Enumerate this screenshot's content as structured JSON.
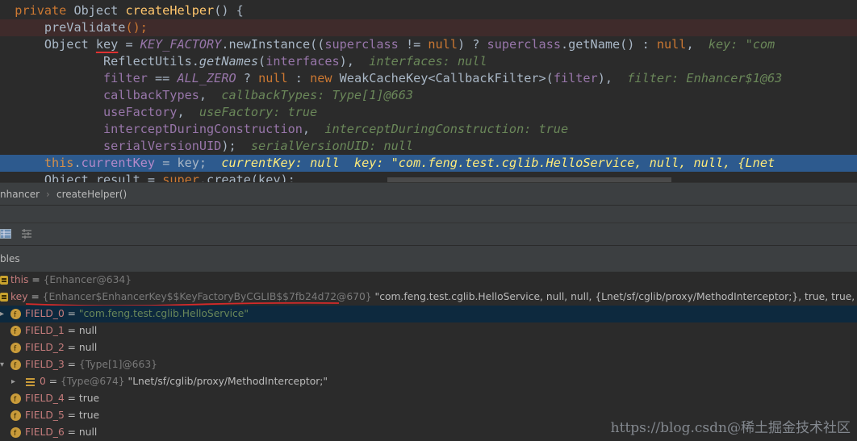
{
  "code": {
    "line1": {
      "kw": "private",
      "type": " Object ",
      "fn": "createHelper",
      "rest": "() {"
    },
    "line2": {
      "call": "preValidate",
      "rest": "();"
    },
    "line3": {
      "a": "Object ",
      "key": "key",
      "b": " = ",
      "const": "KEY_FACTORY",
      "c": ".newInstance((",
      "fld1": "superclass",
      "d": " != ",
      "kw": "null",
      "e": ") ? ",
      "fld2": "superclass",
      "f": ".getName() : ",
      "kw2": "null",
      "g": ",  ",
      "hint": "key: \"com"
    },
    "line4": {
      "a": "ReflectUtils.",
      "st": "getNames",
      "b": "(",
      "fld": "interfaces",
      "c": "),  ",
      "hint": "interfaces: null"
    },
    "line5": {
      "fld": "filter",
      "a": " == ",
      "const": "ALL_ZERO",
      "b": " ? ",
      "kw": "null",
      "c": " : ",
      "kw2": "new",
      "d": " WeakCacheKey<CallbackFilter>(",
      "fld2": "filter",
      "e": "),  ",
      "hint": "filter: Enhancer$1@63"
    },
    "line6": {
      "fld": "callbackTypes",
      "a": ",  ",
      "hint": "callbackTypes: Type[1]@663"
    },
    "line7": {
      "fld": "useFactory",
      "a": ",  ",
      "hint": "useFactory: true"
    },
    "line8": {
      "fld": "interceptDuringConstruction",
      "a": ",  ",
      "hint": "interceptDuringConstruction: true"
    },
    "line9": {
      "fld": "serialVersionUID",
      "a": ");  ",
      "hint": "serialVersionUID: null"
    },
    "line10": {
      "kw": "this",
      "a": ".",
      "fld": "currentKey",
      "b": " = key;  ",
      "hint": "currentKey: null  key: \"com.feng.test.cglib.HelloService, null, null, {Lnet"
    },
    "line11": {
      "a": "Object result = ",
      "kw": "super",
      "b": ".create(key);"
    }
  },
  "breadcrumb": {
    "item1": "nhancer",
    "sep": "›",
    "item2": "createHelper()"
  },
  "panel": {
    "title": "bles"
  },
  "toolbar": {
    "icon1": "table-icon",
    "icon2": "settings-icon"
  },
  "vars": {
    "this": {
      "name": "this",
      "eq": " = ",
      "type": "{Enhancer@634}"
    },
    "key": {
      "name": "key",
      "eq": " = ",
      "type": "{Enhancer$EnhancerKey$$KeyFactoryByCGLIB$$7fb24d72@670}",
      "value": " \"com.feng.test.cglib.HelloService, null, null, {Lnet/sf/cglib/proxy/MethodInterceptor;}, true, true, null\""
    },
    "f0": {
      "name": "FIELD_0",
      "eq": " = ",
      "value": "\"com.feng.test.cglib.HelloService\""
    },
    "f1": {
      "name": "FIELD_1",
      "eq": " = ",
      "value": "null"
    },
    "f2": {
      "name": "FIELD_2",
      "eq": " = ",
      "value": "null"
    },
    "f3": {
      "name": "FIELD_3",
      "eq": " = ",
      "type": "{Type[1]@663}"
    },
    "f3_0": {
      "name": "0",
      "eq": " = ",
      "type": "{Type@674}",
      "value": " \"Lnet/sf/cglib/proxy/MethodInterceptor;\""
    },
    "f4": {
      "name": "FIELD_4",
      "eq": " = ",
      "value": "true"
    },
    "f5": {
      "name": "FIELD_5",
      "eq": " = ",
      "value": "true"
    },
    "f6": {
      "name": "FIELD_6",
      "eq": " = ",
      "value": "null"
    }
  },
  "watermark": "https://blog.csdn@稀土掘金技术社区"
}
